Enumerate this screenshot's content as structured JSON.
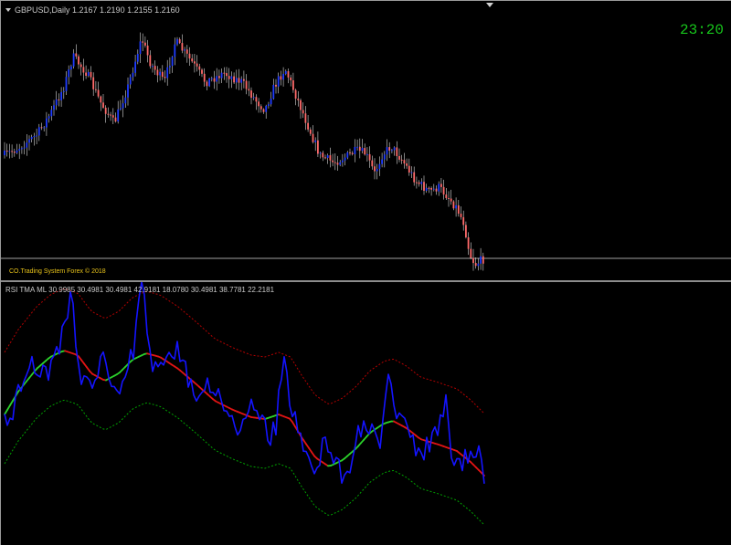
{
  "main_chart": {
    "title": "GBPUSD,Daily  1.2167 1.2190 1.2155 1.2160",
    "clock": "23:20",
    "copyright": "CO.Trading System Forex © 2018",
    "colors": {
      "bull": "#1f3cff",
      "bear": "#ff6a6a",
      "wick": "#d8d8d8",
      "price_line": "#a0a0a0",
      "clock": "#17c41b"
    }
  },
  "indicator": {
    "title": "RSI TMA ML 30.9985 30.4981 30.4981 42.9181 18.0780 30.4981 38.7781 22.2181",
    "colors": {
      "rsi": "#1414ff",
      "tma_up": "#2bd12b",
      "tma_down": "#e21414",
      "upper_band": "#b30000",
      "lower_band": "#00a000"
    }
  }
}
